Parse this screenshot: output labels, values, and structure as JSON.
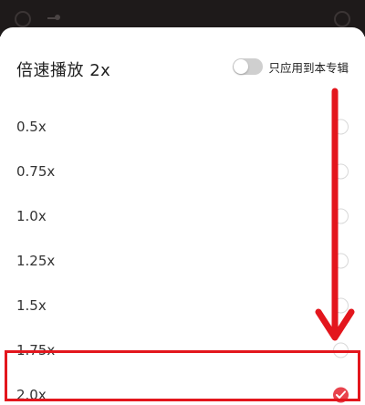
{
  "header": {
    "title": "倍速播放 2x",
    "album_toggle": {
      "label": "只应用到本专辑",
      "on": false
    }
  },
  "speed_options": [
    {
      "label": "0.5x",
      "selected": false
    },
    {
      "label": "0.75x",
      "selected": false
    },
    {
      "label": "1.0x",
      "selected": false
    },
    {
      "label": "1.25x",
      "selected": false
    },
    {
      "label": "1.5x",
      "selected": false
    },
    {
      "label": "1.75x",
      "selected": false
    },
    {
      "label": "2.0x",
      "selected": true
    }
  ],
  "colors": {
    "accent": "#e8434d",
    "annotation": "#e3161d",
    "backdrop": "#1e1a1a"
  },
  "icons": {
    "checked_radio": "check-icon",
    "annotation_arrow": "arrow-down-icon"
  }
}
